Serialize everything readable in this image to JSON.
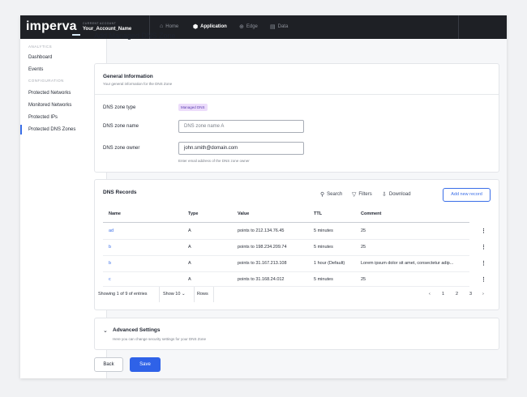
{
  "topbar": {
    "logo": "imperva",
    "account_label": "CURRENT ACCOUNT",
    "account_name": "Your_Account_Name",
    "nav": [
      {
        "label": "Home",
        "icon": "home-icon"
      },
      {
        "label": "Application",
        "icon": "shield-icon"
      },
      {
        "label": "Edge",
        "icon": "globe-icon"
      },
      {
        "label": "Data",
        "icon": "database-icon"
      }
    ],
    "active_nav": "Application"
  },
  "sidebar": {
    "analytics_label": "ANALYTICS",
    "analytics_items": [
      "Dashboard",
      "Events"
    ],
    "configuration_label": "CONFIGURATION",
    "configuration_items": [
      "Protected Networks",
      "Monitored Networks",
      "Protected IPs",
      "Protected DNS Zones"
    ],
    "active_item": "Protected DNS Zones"
  },
  "page": {
    "title": "Add Managed DNS Zone"
  },
  "general": {
    "title": "General Information",
    "subtitle": "Your general information for the DNS Zone",
    "zone_type_label": "DNS zone type",
    "zone_type_value": "Managed DNS",
    "zone_name_label": "DNS zone name",
    "zone_name_placeholder": "DNS zone name A",
    "zone_owner_label": "DNS zone owner",
    "zone_owner_value": "john.smith@domain.com",
    "zone_owner_hint": "Enter email address of the DNS zone owner"
  },
  "records": {
    "title": "DNS Records",
    "search_label": "Search",
    "filters_label": "Filters",
    "download_label": "Download",
    "add_label": "Add new record",
    "columns": [
      "Name",
      "Type",
      "Value",
      "TTL",
      "Comment"
    ],
    "rows": [
      {
        "name": "ad",
        "type": "A",
        "value": "points to 212.134.76.45",
        "ttl": "5 minutes",
        "comment": "25"
      },
      {
        "name": "b",
        "type": "A",
        "value": "points to 198.234.209.74",
        "ttl": "5 minutes",
        "comment": "25"
      },
      {
        "name": "b",
        "type": "A",
        "value": "points to 31.167.213.108",
        "ttl": "1 hour (Default)",
        "comment": "Lorem ipsum dolor sit amet, consectetur adip..."
      },
      {
        "name": "c",
        "type": "A",
        "value": "points to 31.168.24.012",
        "ttl": "5 minutes",
        "comment": "25"
      }
    ],
    "showing_text": "Showing 1 of 9 of entries",
    "show_label": "Show",
    "show_value": "10",
    "rows_label": "Rows",
    "pages": [
      "1",
      "2",
      "3"
    ],
    "prev_icon": "‹",
    "next_icon": "›"
  },
  "advanced": {
    "title": "Advanced Settings",
    "subtitle": "Here you can change security settings for your DNS Zone"
  },
  "actions": {
    "back_label": "Back",
    "save_label": "Save"
  },
  "colors": {
    "accent": "#2f62e8",
    "topbar": "#1e2025",
    "badge_bg": "#ecdcfb"
  }
}
